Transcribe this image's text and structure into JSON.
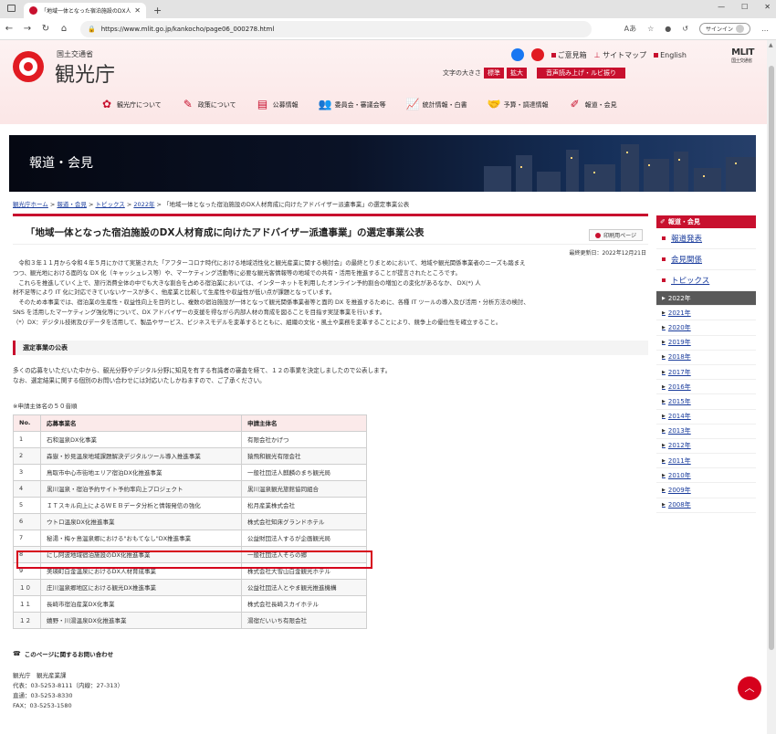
{
  "browser": {
    "tab_title": "「地域一体となった宿泊施設のDX人…",
    "url": "https://www.mlit.go.jp/kankocho/page06_000278.html",
    "signin_label": "サインイン"
  },
  "header": {
    "logo_small": "国土交通省",
    "logo_big": "観光庁",
    "links": [
      "ご意見箱",
      "サイトマップ",
      "English"
    ],
    "mlit_logo": "MLIT",
    "mlit_sub": "国土交通省",
    "fontsize_label": "文字の大きさ",
    "fontsize_standard": "標準",
    "fontsize_large": "拡大",
    "reader_button": "音声読み上げ・ルビ振り",
    "nav": [
      "観光庁について",
      "政策について",
      "公募情報",
      "委員会・審議会等",
      "統計情報・白書",
      "予算・調達情報",
      "報道・会見"
    ]
  },
  "hero": {
    "title": "報道・会見"
  },
  "breadcrumb": {
    "items": [
      "観光庁ホーム",
      "報道・会見",
      "トピックス",
      "2022年"
    ],
    "current": "「地域一体となった宿泊施設のDX人材育成に向けたアドバイザー派遣事業」の選定事業公表"
  },
  "main": {
    "title": "「地域一体となった宿泊施設のDX人材育成に向けたアドバイザー派遣事業」の選定事業公表",
    "print_label": "印刷用ページ",
    "updated": "最終更新日：2022年12月21日",
    "intro": [
      "　令和３年１１月から令和４年５月にかけて実施された「アフターコロナ時代における地域活性化と観光産業に関する検討会」の最終とりまとめにおいて、地域や観光関係事業者のニーズも踏まえ",
      "つつ、観光地における面的な DX 化（キャッシュレス等）や、マーケティング活動等に必要な観光客情報等の地域での共有・活用を推進することが提言されたところです。",
      "　これらを推進していく上で、旅行消費全体の中でも大きな割合を占める宿泊業においては、インターネットを利用したオンライン予約割合の増加との変化があるなか、 DX(*) 人",
      "材不足等により IT 化に対応できていないケースが多く、他産業と比較して生産性や収益性が低い点が課題となっています。",
      "　そのため本事業では、宿泊業の生産性・収益性向上を目的とし、複数の宿泊施設が一体となって観光関係事業者等と面的 DX を推進するために、各種 IT ツールの導入及び活用・分析方法の検討、",
      "SNS を活用したマーケティング強化等について、DX アドバイザーの支援を得ながら内部人材の育成を図ることを目指す実証事業を行います。",
      "（*）DX：デジタル技術及びデータを活用して、製品やサービス、ビジネスモデルを変革するとともに、組織の文化・風土や業務を変革することにより、競争上の優位性を確立すること。"
    ],
    "section_title": "選定事業の公表",
    "section_body": [
      "多くの応募をいただいた中から、観光分野やデジタル分野に知見を有する有識者の審査を経て、１２の事業を決定しましたので公表します。",
      "なお、選定結果に関する個別のお問い合わせには対応いたしかねますので、ご了承ください。"
    ],
    "note": "※申請主体名の５０音順",
    "table": {
      "headers": [
        "No.",
        "応募事業名",
        "申請主体名"
      ],
      "rows": [
        [
          "1",
          "石和温泉DX化事業",
          "有限会社かげつ"
        ],
        [
          "2",
          "森嶽・妙見温泉地域課題解決デジタルツール導入推進事業",
          "猿飛和観光有限会社"
        ],
        [
          "3",
          "鳥取市中心市街地エリア宿泊DX化推進事業",
          "一般社団法人麒麟のまち観光局"
        ],
        [
          "4",
          "黒川温泉・宿泊予約サイト予約率向上プロジェクト",
          "黒川温泉観光旅館協同組合"
        ],
        [
          "5",
          "ＩＴスキル向上によるＷＥＢデータ分析と情報発信の強化",
          "松月産業株式会社"
        ],
        [
          "6",
          "ウトロ温泉DX化推進事業",
          "株式会社知床グランドホテル"
        ],
        [
          "7",
          "秘湯・梅ヶ島温泉郷における\"おもてなし\"DX推進事業",
          "公益財団法人するが企画観光局"
        ],
        [
          "8",
          "にし阿波地域宿泊施設のDX化推進事業",
          "一般社団法人そらの郷"
        ],
        [
          "9",
          "美瑛町白金温泉におけるDX人材育成事業",
          "株式会社大雪山白金観光ホテル"
        ],
        [
          "１０",
          "庄川温泉郷地区における観光DX推進事業",
          "公益社団法人とやま観光推進機構"
        ],
        [
          "１１",
          "長崎市宿泊産業DX化事業",
          "株式会社長崎スカイホテル"
        ],
        [
          "１２",
          "嬉野・川湯温泉DX化推進事業",
          "湯宿だいいち有限会社"
        ]
      ]
    },
    "contact_title": "このページに関するお問い合わせ",
    "contact_lines": [
      "観光庁　観光産業課",
      "代表：03-5253-8111（内線：27-313）",
      "直通：03-5253-8330",
      "FAX：03-5253-1580"
    ]
  },
  "sidebar": {
    "header": "報道・会見",
    "links": [
      "報道発表",
      "会見関係",
      "トピックス"
    ],
    "years": [
      "2022年",
      "2021年",
      "2020年",
      "2019年",
      "2018年",
      "2017年",
      "2016年",
      "2015年",
      "2014年",
      "2013年",
      "2012年",
      "2011年",
      "2010年",
      "2009年",
      "2008年"
    ],
    "active_year": "2022年"
  },
  "colors": {
    "accent": "#c8102e",
    "link": "#1a3c9c",
    "highlight": "#d6001c"
  }
}
